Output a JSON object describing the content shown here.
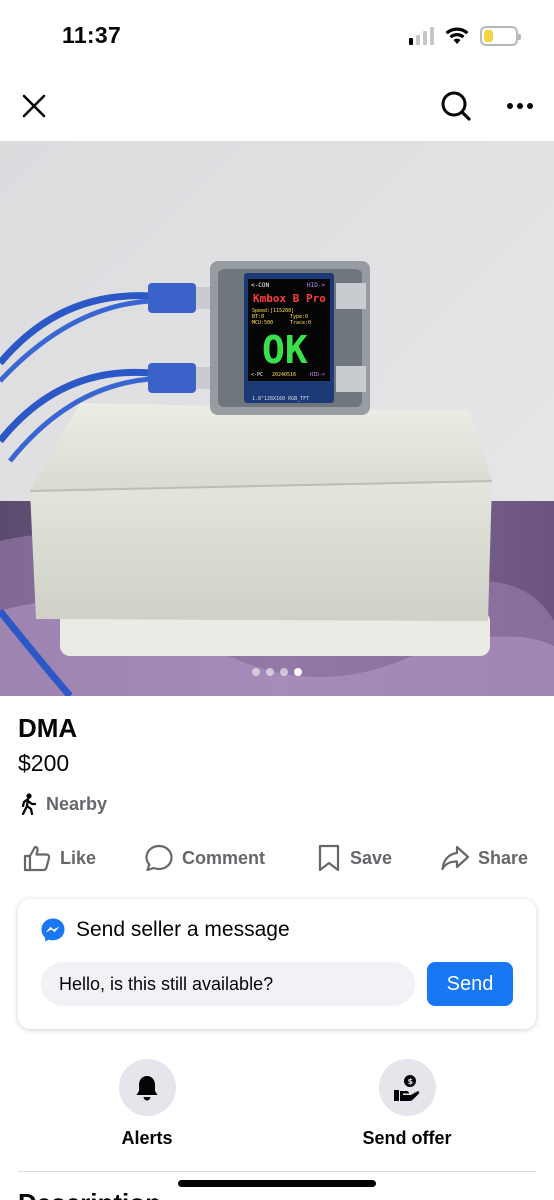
{
  "status_bar": {
    "time": "11:37",
    "battery_fill": 0.3,
    "signal_bars": 1
  },
  "nav": {
    "close_icon": "close-icon",
    "search_icon": "search-icon",
    "more_icon": "more-icon"
  },
  "photo": {
    "description_icon": "product-photo",
    "device_screen": {
      "top_left": "<-CON",
      "top_right": "HID->",
      "title": "Kmbox B Pro",
      "line1": "Speed:[115200]",
      "line2a": "BT:0",
      "line2b": "Type:0",
      "line3a": "MCU:500",
      "line3b": "Trace:0",
      "status": "OK",
      "bottom_left": "<-PC",
      "bottom_mid": "20240516",
      "bottom_right": "HID->",
      "label": "1.8\"128X160 RGB_TFT"
    },
    "carousel": {
      "count": 4,
      "active": 3
    }
  },
  "listing": {
    "title": "DMA",
    "price": "$200",
    "location": "Nearby"
  },
  "actions": {
    "like": "Like",
    "comment": "Comment",
    "save": "Save",
    "share": "Share"
  },
  "message": {
    "title": "Send seller a message",
    "input_value": "Hello, is this still available?",
    "send_label": "Send"
  },
  "quick_actions": {
    "alerts": "Alerts",
    "send_offer": "Send offer"
  },
  "next_section": {
    "heading": "Description"
  },
  "colors": {
    "accent": "#1877f2",
    "secondary_text": "#65676b",
    "battery": "#f5d443"
  }
}
